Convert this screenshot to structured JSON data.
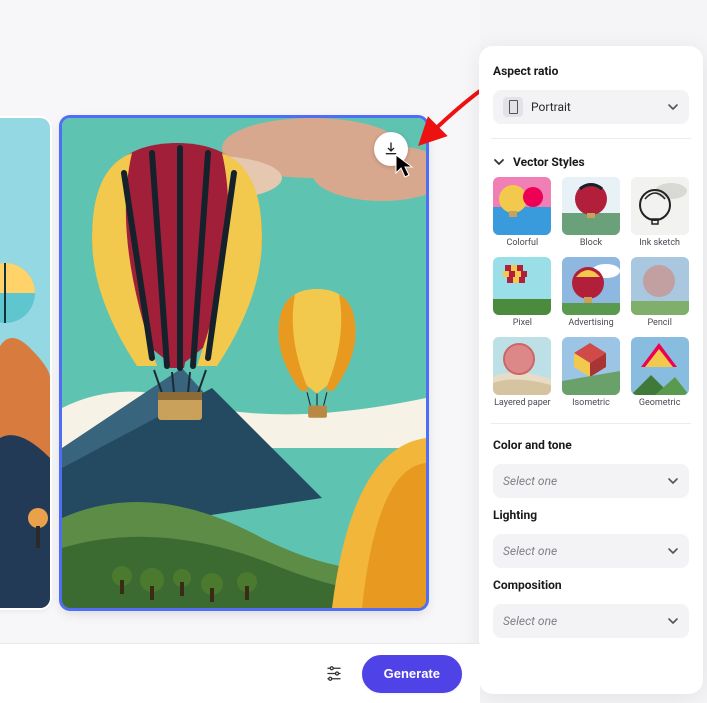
{
  "panel": {
    "aspect": {
      "title": "Aspect ratio",
      "value": "Portrait"
    },
    "vectorStyles": {
      "title": "Vector Styles",
      "items": [
        {
          "label": "Colorful"
        },
        {
          "label": "Block"
        },
        {
          "label": "Ink sketch"
        },
        {
          "label": "Pixel"
        },
        {
          "label": "Advertising"
        },
        {
          "label": "Pencil"
        },
        {
          "label": "Layered paper"
        },
        {
          "label": "Isometric"
        },
        {
          "label": "Geometric"
        }
      ]
    },
    "colorTone": {
      "title": "Color and tone",
      "placeholder": "Select one"
    },
    "lighting": {
      "title": "Lighting",
      "placeholder": "Select one"
    },
    "composition": {
      "title": "Composition",
      "placeholder": "Select one"
    }
  },
  "toolbar": {
    "generate_label": "Generate"
  }
}
